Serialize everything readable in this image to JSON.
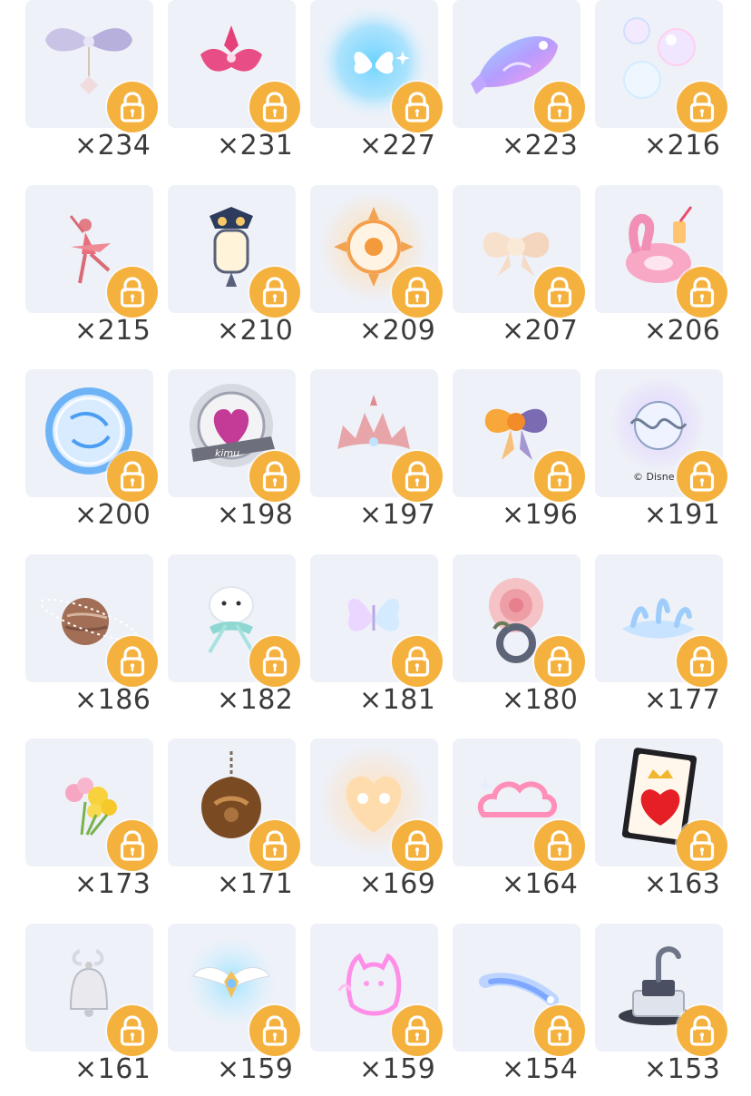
{
  "items": [
    {
      "count": "×234",
      "icon": "ribbon-bow-charm-icon"
    },
    {
      "count": "×231",
      "icon": "pink-crest-icon"
    },
    {
      "count": "×227",
      "icon": "blue-glow-butterfly-icon"
    },
    {
      "count": "×223",
      "icon": "iridescent-fish-icon"
    },
    {
      "count": "×216",
      "icon": "bubbles-icon"
    },
    {
      "count": "×215",
      "icon": "ballerina-icon"
    },
    {
      "count": "×210",
      "icon": "owl-lantern-icon"
    },
    {
      "count": "×209",
      "icon": "golden-sun-emblem-icon"
    },
    {
      "count": "×207",
      "icon": "cream-bow-icon"
    },
    {
      "count": "×206",
      "icon": "flamingo-float-icon"
    },
    {
      "count": "×200",
      "icon": "blue-ring-orb-icon"
    },
    {
      "count": "×198",
      "icon": "heart-badge-icon",
      "badge_text": "kimu"
    },
    {
      "count": "×197",
      "icon": "pink-tiara-icon"
    },
    {
      "count": "×196",
      "icon": "halloween-bow-icon"
    },
    {
      "count": "×191",
      "icon": "vine-bubble-icon",
      "overlay_text": "© Disne"
    },
    {
      "count": "×186",
      "icon": "planet-icon"
    },
    {
      "count": "×182",
      "icon": "seal-with-ribbon-icon"
    },
    {
      "count": "×181",
      "icon": "glowing-butterfly-icon"
    },
    {
      "count": "×180",
      "icon": "rose-ring-icon"
    },
    {
      "count": "×177",
      "icon": "water-splash-icon"
    },
    {
      "count": "×173",
      "icon": "flower-bouquet-icon"
    },
    {
      "count": "×171",
      "icon": "bronze-pendant-icon"
    },
    {
      "count": "×169",
      "icon": "glowing-heart-icon"
    },
    {
      "count": "×164",
      "icon": "neon-cloud-icon"
    },
    {
      "count": "×163",
      "icon": "heart-card-icon"
    },
    {
      "count": "×161",
      "icon": "silver-bell-icon"
    },
    {
      "count": "×159",
      "icon": "winged-emblem-icon"
    },
    {
      "count": "×159",
      "icon": "neon-cat-ghost-icon"
    },
    {
      "count": "×154",
      "icon": "blue-comet-icon"
    },
    {
      "count": "×153",
      "icon": "hook-jar-icon"
    }
  ],
  "colors": {
    "tile_bg": "#eef1f8",
    "lock_badge": "#f5b13d",
    "count_text": "#3b3b3b"
  }
}
